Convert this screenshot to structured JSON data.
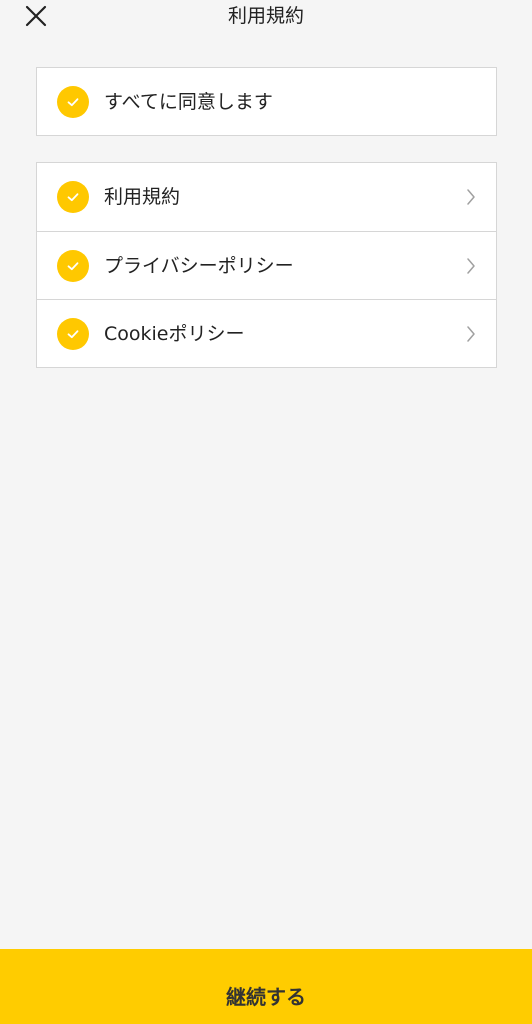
{
  "header": {
    "title": "利用規約",
    "close_icon": "close-icon"
  },
  "agree_all": {
    "label": "すべてに同意します",
    "checked": true
  },
  "items": [
    {
      "label": "利用規約",
      "checked": true
    },
    {
      "label": "プライバシーポリシー",
      "checked": true
    },
    {
      "label": "Cookieポリシー",
      "checked": true
    }
  ],
  "footer": {
    "continue_label": "継続する"
  },
  "colors": {
    "accent": "#ffc800",
    "button": "#ffcc00",
    "background": "#f5f5f5",
    "border": "#d6d6d6"
  }
}
